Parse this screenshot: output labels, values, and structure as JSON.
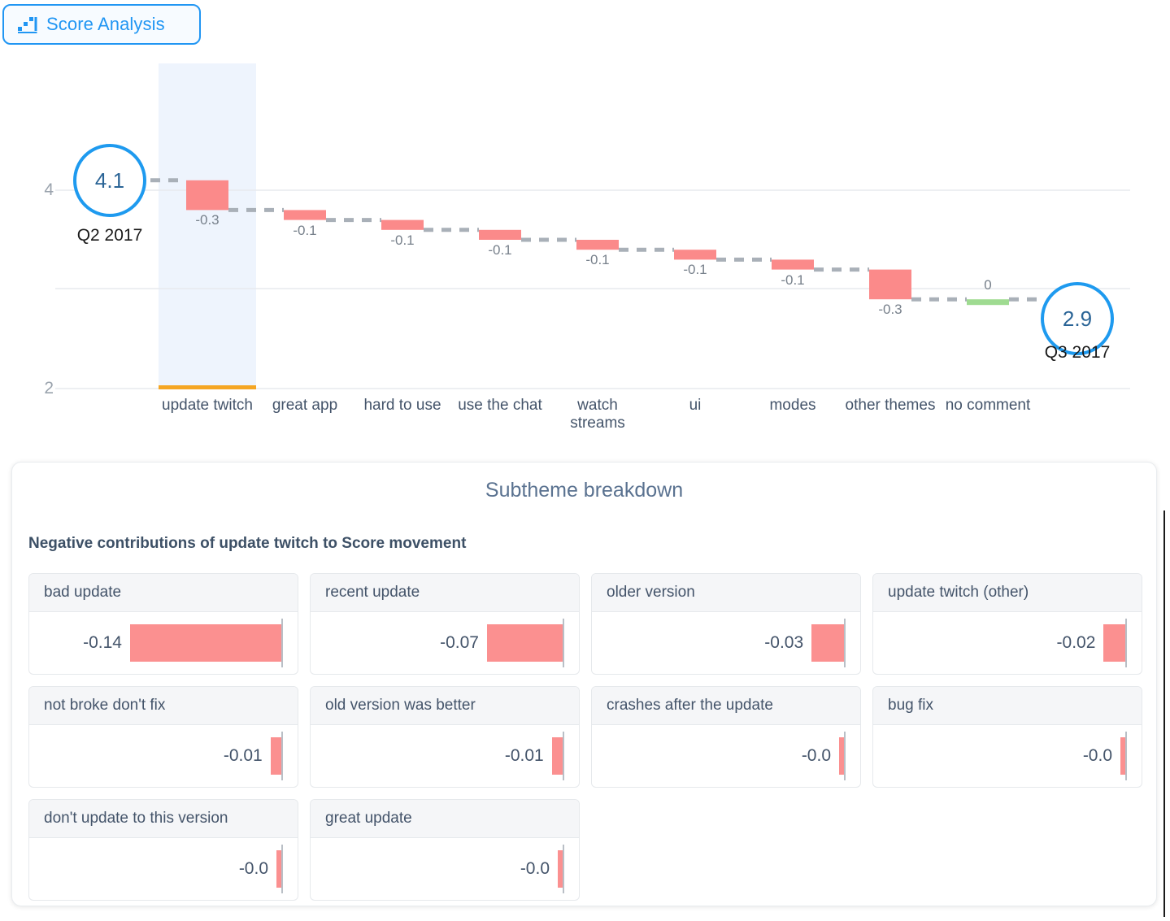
{
  "tab": {
    "label": "Score Analysis",
    "icon": "bar-chart-icon",
    "accent_color": "#2196f3"
  },
  "chart_data": {
    "type": "bar",
    "chart_subtype": "waterfall",
    "title": "",
    "xlabel": "",
    "ylabel": "",
    "ylim": [
      2,
      4.35
    ],
    "ytick_labels": [
      "4",
      "2"
    ],
    "yticks": [
      4,
      3,
      2
    ],
    "grid": true,
    "legend": null,
    "start": {
      "label": "Q2 2017",
      "value": "4.1",
      "numeric": 4.1
    },
    "end": {
      "label": "Q3 2017",
      "value": "2.9",
      "numeric": 2.9
    },
    "categories": [
      "update twitch",
      "great app",
      "hard to use",
      "use the chat",
      "watch streams",
      "ui",
      "modes",
      "other themes",
      "no comment"
    ],
    "value_labels": [
      "-0.3",
      "-0.1",
      "-0.1",
      "-0.1",
      "-0.1",
      "-0.1",
      "-0.1",
      "-0.3",
      "0"
    ],
    "values": [
      -0.3,
      -0.1,
      -0.1,
      -0.1,
      -0.1,
      -0.1,
      -0.1,
      -0.3,
      0
    ],
    "bar_colors": [
      "#fb8a8a",
      "#fb8a8a",
      "#fb8a8a",
      "#fb8a8a",
      "#fb8a8a",
      "#fb8a8a",
      "#fb8a8a",
      "#fb8a8a",
      "#9fdb91"
    ],
    "negative_color": "#fb8a8a",
    "positive_color": "#9fdb91",
    "selected_category": "update twitch",
    "selected_highlight_color": "#eef4fd",
    "selected_underline_color": "#f5a623",
    "connector_style": "dashed",
    "connector_color": "#a9b0b8"
  },
  "panel": {
    "title": "Subtheme breakdown",
    "subtitle": "Negative contributions of update twitch to Score movement",
    "cards": [
      {
        "name": "bad update",
        "value": "-0.14",
        "magnitude": 0.14
      },
      {
        "name": "recent update",
        "value": "-0.07",
        "magnitude": 0.07
      },
      {
        "name": "older version",
        "value": "-0.03",
        "magnitude": 0.03
      },
      {
        "name": "update twitch (other)",
        "value": "-0.02",
        "magnitude": 0.02
      },
      {
        "name": "not broke don't fix",
        "value": "-0.01",
        "magnitude": 0.01
      },
      {
        "name": "old version was better",
        "value": "-0.01",
        "magnitude": 0.01
      },
      {
        "name": "crashes after the update",
        "value": "-0.0",
        "magnitude": 0.004
      },
      {
        "name": "bug fix",
        "value": "-0.0",
        "magnitude": 0.004
      },
      {
        "name": "don't update to this version",
        "value": "-0.0",
        "magnitude": 0.003
      },
      {
        "name": "great update",
        "value": "-0.0",
        "magnitude": 0.003
      }
    ]
  }
}
